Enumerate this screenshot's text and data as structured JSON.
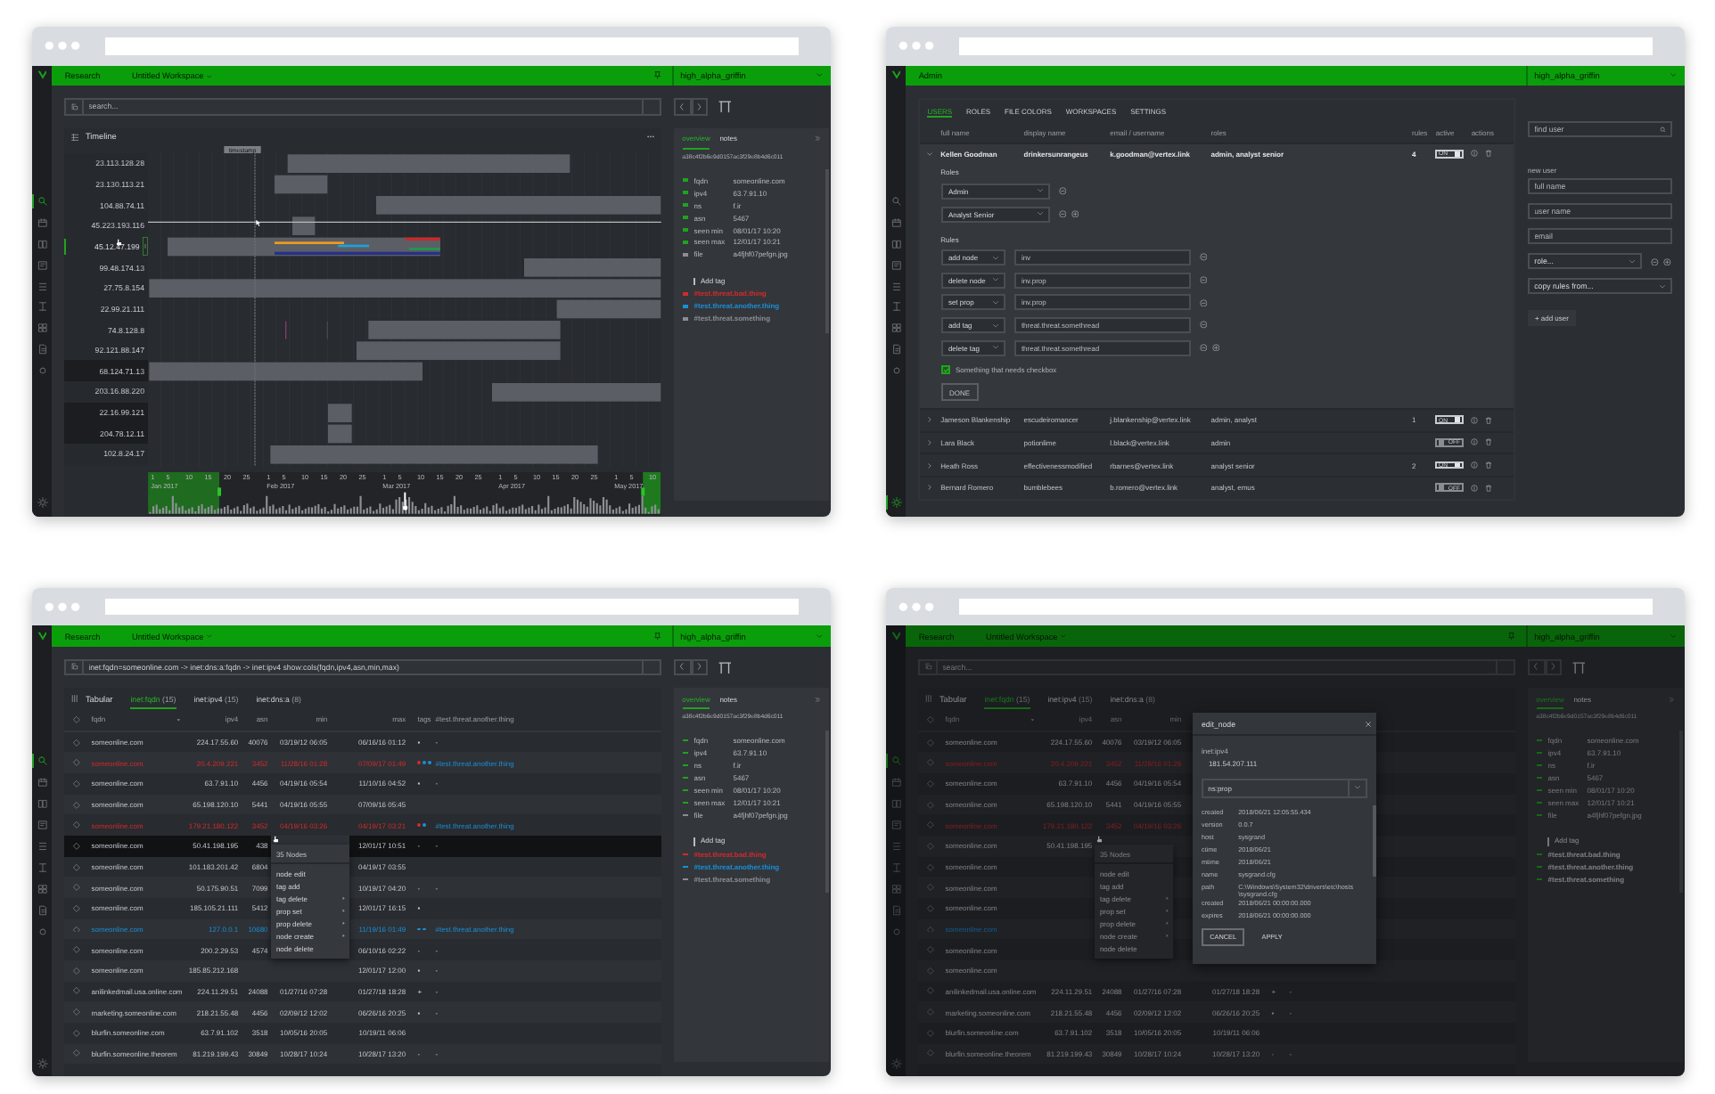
{
  "windows": [
    {
      "nav": [
        {
          "selected": true
        },
        {
          "selected": false
        },
        {
          "selected": false
        },
        {
          "selected": false
        },
        {
          "selected": false
        },
        {
          "selected": false
        },
        {
          "selected": false
        },
        {
          "selected": false
        },
        {
          "selected": false
        }
      ],
      "settings": {
        "selected": false
      },
      "topbar": {
        "section": "Research",
        "workspace": "Untitled Workspace",
        "user": "high_alpha_griffin"
      },
      "search": {
        "placeholder": "search..."
      },
      "center": {
        "kind": "timeline",
        "title": "Timeline",
        "cursor_label": "timestamp",
        "rows": [
          {
            "label": "23.113.128.28",
            "selected": false,
            "highlighted": false
          },
          {
            "label": "23.130.113.21",
            "selected": false,
            "highlighted": false
          },
          {
            "label": "104.88.74.11",
            "selected": false,
            "highlighted": false
          },
          {
            "label": "45.223.193.116",
            "selected": false,
            "highlighted": false
          },
          {
            "label": "45.12.47.199",
            "selected": true,
            "highlighted": false
          },
          {
            "label": "99.48.174.13",
            "selected": false,
            "highlighted": false
          },
          {
            "label": "27.75.8.154",
            "selected": false,
            "highlighted": false
          },
          {
            "label": "22.99.21.111",
            "selected": false,
            "highlighted": false
          },
          {
            "label": "74.8.128.8",
            "selected": false,
            "highlighted": false
          },
          {
            "label": "92.121.88.147",
            "selected": false,
            "highlighted": false
          },
          {
            "label": "68.124.71.13",
            "selected": false,
            "highlighted": true
          },
          {
            "label": "203.16.88.220",
            "selected": false,
            "highlighted": false
          },
          {
            "label": "22.16.99.121",
            "selected": false,
            "highlighted": true
          },
          {
            "label": "204.78.12.11",
            "selected": false,
            "highlighted": true
          },
          {
            "label": "102.8.24.17",
            "selected": false,
            "highlighted": false
          }
        ],
        "axis": [
          {
            "month": "Jan 2017",
            "days": [
              "1",
              "5",
              "10",
              "15",
              "20",
              "25"
            ]
          },
          {
            "month": "Feb 2017",
            "days": [
              "1",
              "5",
              "10",
              "15",
              "20",
              "25"
            ]
          },
          {
            "month": "Mar 2017",
            "days": [
              "1",
              "5",
              "10",
              "15",
              "20",
              "25"
            ]
          },
          {
            "month": "Apr 2017",
            "days": [
              "1",
              "5",
              "10",
              "15",
              "20",
              "25"
            ]
          },
          {
            "month": "May 2017",
            "days": [
              "1",
              "5",
              "10"
            ]
          }
        ]
      },
      "details": {
        "tabs": [
          {
            "label": "overview",
            "selected": true
          },
          {
            "label": "notes",
            "selected": false
          }
        ],
        "id": "a38c4f2b6e9d0157ac3f29e8b4d6c011",
        "props": [
          {
            "key": "fqdn",
            "value": "someonline.com",
            "color": "#1fa31f"
          },
          {
            "key": "ipv4",
            "value": "63.7.91.10",
            "color": "#1fa31f"
          },
          {
            "key": "ns",
            "value": "f.ir",
            "color": "#1fa31f"
          },
          {
            "key": "asn",
            "value": "5467",
            "color": "#1fa31f"
          },
          {
            "key": "seen min",
            "value": "08/01/17 10:20",
            "color": "#1fa31f"
          },
          {
            "key": "seen max",
            "value": "12/01/17 10:21",
            "color": "#1fa31f"
          },
          {
            "key": "file",
            "value": "a4fjhf07pefgn.jpg",
            "color": "#8a8e93"
          }
        ],
        "add_tag": "Add tag",
        "tags": [
          {
            "label": "#test.threat.bad.thing",
            "color": "#d22b2b"
          },
          {
            "label": "#test.threat.another.thing",
            "color": "#1a8fd6"
          },
          {
            "label": "#test.threat.something",
            "color": "#8a8e93"
          }
        ]
      }
    },
    {
      "nav": [
        {
          "selected": false
        },
        {
          "selected": false
        },
        {
          "selected": false
        },
        {
          "selected": false
        },
        {
          "selected": false
        },
        {
          "selected": false
        },
        {
          "selected": false
        },
        {
          "selected": false
        },
        {
          "selected": false
        }
      ],
      "settings": {
        "selected": true
      },
      "topbar": {
        "section": "Admin",
        "user": "high_alpha_griffin"
      },
      "center": {
        "kind": "admin",
        "tabs": [
          {
            "label": "USERS",
            "selected": true
          },
          {
            "label": "ROLES",
            "selected": false
          },
          {
            "label": "FILE COLORS",
            "selected": false
          },
          {
            "label": "WORKSPACES",
            "selected": false
          },
          {
            "label": "SETTINGS",
            "selected": false
          }
        ],
        "columns": [
          "full name",
          "display name",
          "email / username",
          "roles",
          "rules",
          "active",
          "actions"
        ],
        "users": [
          {
            "name": "Kellen Goodman",
            "display": "drinkersunrangeus",
            "email": "k.goodman@vertex.link",
            "roles": "admin, analyst senior",
            "rules": "4",
            "active": true,
            "active_label": "ON",
            "expanded": true
          },
          {
            "name": "Jameson Blankenship",
            "display": "escudeiromancer",
            "email": "j.blankenship@vertex.link",
            "roles": "admin, analyst",
            "rules": "1",
            "active": true,
            "active_label": "ON",
            "expanded": false
          },
          {
            "name": "Lara Black",
            "display": "potionlime",
            "email": "l.black@vertex.link",
            "roles": "admin",
            "active": false,
            "active_label": "OFF",
            "expanded": false
          },
          {
            "name": "Heath Ross",
            "display": "effectivenessmodified",
            "email": "rbarnes@vertex.link",
            "roles": "analyst senior",
            "rules": "2",
            "active": true,
            "active_label": "ON",
            "expanded": false
          },
          {
            "name": "Bernard Romero",
            "display": "bumblebees",
            "email": "b.romero@vertex.link",
            "roles": "analyst, emus",
            "active": false,
            "active_label": "OFF",
            "expanded": false
          }
        ],
        "editor": {
          "roles_label": "Roles",
          "roles": [
            "Admin",
            "Analyst Senior"
          ],
          "rules_label": "Rules",
          "rules": [
            {
              "action": "add node",
              "value": "inv"
            },
            {
              "action": "delete node",
              "value": "inv.prop"
            },
            {
              "action": "set prop",
              "value": "inv.prop"
            },
            {
              "action": "add tag",
              "value": "threat.threat.somethread"
            },
            {
              "action": "delete tag",
              "value": "threat.threat.somethread"
            }
          ],
          "checkbox": {
            "label": "Something that needs checkbox",
            "checked": true
          },
          "done": "DONE"
        }
      },
      "user_form": {
        "search_placeholder": "find user",
        "title": "new user",
        "fields": [
          {
            "placeholder": "full name"
          },
          {
            "placeholder": "user name"
          },
          {
            "placeholder": "email"
          }
        ],
        "role_select": "role...",
        "copy_select": "copy rules from...",
        "add": "+ add user"
      }
    },
    {
      "nav": [
        {
          "selected": true
        },
        {
          "selected": false
        },
        {
          "selected": false
        },
        {
          "selected": false
        },
        {
          "selected": false
        },
        {
          "selected": false
        },
        {
          "selected": false
        },
        {
          "selected": false
        },
        {
          "selected": false
        }
      ],
      "settings": {
        "selected": false
      },
      "topbar": {
        "section": "Research",
        "workspace": "Untitled Workspace",
        "user": "high_alpha_griffin"
      },
      "search": {
        "value": "inet:fqdn=someonline.com -> inet:dns:a:fqdn -> inet:ipv4 show:cols(fqdn,ipv4,asn,min,max)"
      },
      "center": {
        "kind": "table",
        "title": "Tabular",
        "tabs": [
          {
            "label": "inet:fqdn",
            "count": "(15)",
            "selected": true
          },
          {
            "label": "inet:ipv4",
            "count": "(15)",
            "selected": false
          },
          {
            "label": "inet:dns:a",
            "count": "(8)",
            "selected": false
          }
        ],
        "columns": [
          "fqdn",
          "ipv4",
          "asn",
          "min",
          "max",
          "tags",
          "#test.threat.another.thing"
        ],
        "rows": [
          {
            "fqdn": "someonline.com",
            "ipv4": "224.17.55.60",
            "asn": "40076",
            "min": "03/19/12 06:05",
            "max": "06/16/16 01:12",
            "tag_text": "▪",
            "note": "-",
            "flagged": false,
            "watched": false,
            "selected": false
          },
          {
            "fqdn": "someonline.com",
            "ipv4": "20.4.209.221",
            "asn": "3452",
            "min": "11/28/16 01:28",
            "max": "07/09/17 01:49",
            "tags": [
              {
                "color": "#d22b2b"
              },
              {
                "color": "#1a8fd6"
              },
              {
                "color": "#1a8fd6"
              }
            ],
            "note": "#test.threat.another.thing",
            "flagged": true,
            "watched": false,
            "selected": false
          },
          {
            "fqdn": "someonline.com",
            "ipv4": "63.7.91.10",
            "asn": "4456",
            "min": "04/19/16 05:54",
            "max": "11/10/16 04:52",
            "tag_text": "▪",
            "note": "-",
            "flagged": false,
            "watched": false,
            "selected": false
          },
          {
            "fqdn": "someonline.com",
            "ipv4": "65.198.120.10",
            "asn": "5441",
            "min": "04/19/16 05:55",
            "max": "07/09/16 05:45",
            "flagged": false,
            "watched": false,
            "selected": false
          },
          {
            "fqdn": "someonline.com",
            "ipv4": "179.21.180.122",
            "asn": "3452",
            "min": "04/19/16 03:26",
            "max": "04/19/17 03:21",
            "tags": [
              {
                "color": "#d22b2b"
              },
              {
                "color": "#1a8fd6"
              }
            ],
            "note": "#test.threat.another.thing",
            "flagged": true,
            "watched": false,
            "selected": false
          },
          {
            "fqdn": "someonline.com",
            "ipv4": "50.41.198.195",
            "asn": "438",
            "max": "12/01/17 10:51",
            "tag_text": "-",
            "note": "-",
            "flagged": false,
            "watched": false,
            "selected": true
          },
          {
            "fqdn": "someonline.com",
            "ipv4": "101.183.201.42",
            "asn": "6804",
            "max": "04/19/17 03:55",
            "flagged": false,
            "watched": false,
            "selected": false
          },
          {
            "fqdn": "someonline.com",
            "ipv4": "50.175.90.51",
            "asn": "7099",
            "max": "10/19/17 04:20",
            "tag_text": "-",
            "note": "-",
            "flagged": false,
            "watched": false,
            "selected": false
          },
          {
            "fqdn": "someonline.com",
            "ipv4": "185.105.21.111",
            "asn": "5412",
            "max": "12/01/17 16:15",
            "tag_text": "▪",
            "flagged": false,
            "watched": false,
            "selected": false
          },
          {
            "fqdn": "someonline.com",
            "ipv4": "127.0.0.1",
            "asn": "10680",
            "max": "11/19/16 01:49",
            "tags": [
              {
                "color": "#1a8fd6"
              },
              {
                "color": "#1a8fd6"
              }
            ],
            "note": "#test.threat.another.thing",
            "flagged": false,
            "watched": true,
            "selected": false
          },
          {
            "fqdn": "someonline.com",
            "ipv4": "200.2.29.53",
            "asn": "4574",
            "max": "06/10/16 02:22",
            "tag_text": "-",
            "note": "-",
            "flagged": false,
            "watched": false,
            "selected": false
          },
          {
            "fqdn": "someonline.com",
            "ipv4": "185.85.212.168",
            "max": "12/01/17 12:00",
            "tag_text": "▪",
            "note": "-",
            "flagged": false,
            "watched": false,
            "selected": false
          },
          {
            "fqdn": "anilinkedmail.usa.online.com",
            "ipv4": "224.11.29.51",
            "asn": "24088",
            "min": "01/27/16 07:28",
            "max": "01/27/18 18:28",
            "tag_text": "+",
            "note": "-",
            "flagged": false,
            "watched": false,
            "selected": false
          },
          {
            "fqdn": "marketing.someonline.com",
            "ipv4": "218.21.55.48",
            "asn": "4456",
            "min": "02/09/12 12:02",
            "max": "06/26/16 20:25",
            "tag_text": "▪",
            "note": "-",
            "flagged": false,
            "watched": false,
            "selected": false
          },
          {
            "fqdn": "blurfin.someonline.com",
            "ipv4": "63.7.91.102",
            "asn": "3518",
            "min": "10/05/16 20:05",
            "max": "10/19/11 06:06",
            "flagged": false,
            "watched": false,
            "selected": false
          },
          {
            "fqdn": "blurfin.someonline.theorem",
            "ipv4": "81.219.199.43",
            "asn": "30849",
            "min": "10/28/17 10:24",
            "max": "10/28/17 13:20",
            "tag_text": "-",
            "note": "-",
            "flagged": false,
            "watched": false,
            "selected": false
          }
        ]
      },
      "menu": {
        "title": "35 Nodes",
        "items": [
          {
            "label": "node edit",
            "submenu": false
          },
          {
            "label": "tag add",
            "submenu": false
          },
          {
            "label": "tag delete",
            "submenu": true
          },
          {
            "label": "prop set",
            "submenu": true
          },
          {
            "label": "prop delete",
            "submenu": true
          },
          {
            "label": "node create",
            "submenu": true
          },
          {
            "label": "node delete",
            "submenu": false
          }
        ]
      },
      "details": {
        "tabs": [
          {
            "label": "overview",
            "selected": true
          },
          {
            "label": "notes",
            "selected": false
          }
        ],
        "id": "a38c4f2b6e9d0157ac3f29e8b4d6c011",
        "props": [
          {
            "key": "fqdn",
            "value": "someonline.com",
            "color": "#1fa31f"
          },
          {
            "key": "ipv4",
            "value": "63.7.91.10",
            "color": "#1fa31f"
          },
          {
            "key": "ns",
            "value": "f.ir",
            "color": "#1fa31f"
          },
          {
            "key": "asn",
            "value": "5467",
            "color": "#1fa31f"
          },
          {
            "key": "seen min",
            "value": "08/01/17 10:20",
            "color": "#1fa31f"
          },
          {
            "key": "seen max",
            "value": "12/01/17 10:21",
            "color": "#1fa31f"
          },
          {
            "key": "file",
            "value": "a4fjhf07pefgn.jpg",
            "color": "#8a8e93"
          }
        ],
        "add_tag": "Add tag",
        "tags": [
          {
            "label": "#test.threat.bad.thing",
            "color": "#d22b2b"
          },
          {
            "label": "#test.threat.another.thing",
            "color": "#1a8fd6"
          },
          {
            "label": "#test.threat.something",
            "color": "#8a8e93"
          }
        ]
      }
    },
    {
      "nav": [
        {
          "selected": true
        },
        {
          "selected": false
        },
        {
          "selected": false
        },
        {
          "selected": false
        },
        {
          "selected": false
        },
        {
          "selected": false
        },
        {
          "selected": false
        },
        {
          "selected": false
        },
        {
          "selected": false
        }
      ],
      "settings": {
        "selected": false
      },
      "topbar": {
        "section": "Research",
        "workspace": "Untitled Workspace",
        "user": "high_alpha_griffin"
      },
      "search": {
        "placeholder": "search..."
      },
      "center": {
        "kind": "table",
        "title": "Tabular",
        "tabs": [
          {
            "label": "inet:fqdn",
            "count": "(15)",
            "selected": true
          },
          {
            "label": "inet:ipv4",
            "count": "(15)",
            "selected": false
          },
          {
            "label": "inet:dns:a",
            "count": "(8)",
            "selected": false
          }
        ],
        "columns": [
          "fqdn",
          "ipv4",
          "asn",
          "min"
        ],
        "rows": [
          {
            "fqdn": "someonline.com",
            "ipv4": "224.17.55.60",
            "asn": "40076",
            "min": "03/19/12 06:05",
            "flagged": false,
            "watched": false
          },
          {
            "fqdn": "someonline.com",
            "ipv4": "20.4.209.221",
            "asn": "3452",
            "min": "11/28/16 01:28",
            "flagged": true,
            "watched": false
          },
          {
            "fqdn": "someonline.com",
            "ipv4": "63.7.91.10",
            "asn": "4456",
            "min": "04/19/16 05:54",
            "flagged": false,
            "watched": false
          },
          {
            "fqdn": "someonline.com",
            "ipv4": "65.198.120.10",
            "asn": "5441",
            "min": "04/19/16 05:55",
            "flagged": false,
            "watched": false
          },
          {
            "fqdn": "someonline.com",
            "ipv4": "179.21.180.122",
            "asn": "3452",
            "min": "04/19/16 03:26",
            "flagged": true,
            "watched": false
          },
          {
            "fqdn": "someonline.com",
            "ipv4": "50.41.198.195",
            "flagged": false,
            "watched": false
          },
          {
            "fqdn": "someonline.com",
            "flagged": false,
            "watched": false
          },
          {
            "fqdn": "someonline.com",
            "flagged": false,
            "watched": false
          },
          {
            "fqdn": "someonline.com",
            "flagged": false,
            "watched": false
          },
          {
            "fqdn": "someonline.com",
            "flagged": false,
            "watched": true
          },
          {
            "fqdn": "someonline.com",
            "flagged": false,
            "watched": false
          },
          {
            "fqdn": "someonline.com",
            "flagged": false,
            "watched": false
          },
          {
            "fqdn": "anilinkedmail.usa.online.com",
            "ipv4": "224.11.29.51",
            "asn": "24088",
            "min": "01/27/16 07:28",
            "max": "01/27/18 18:28",
            "tag_text": "+",
            "note": "-",
            "flagged": false,
            "watched": false
          },
          {
            "fqdn": "marketing.someonline.com",
            "ipv4": "218.21.55.48",
            "asn": "4456",
            "min": "02/09/12 12:02",
            "max": "06/26/16 20:25",
            "tag_text": "▪",
            "note": "-",
            "flagged": false,
            "watched": false
          },
          {
            "fqdn": "blurfin.someonline.com",
            "ipv4": "63.7.91.102",
            "asn": "3518",
            "min": "10/05/16 20:05",
            "max": "10/19/11 06:06",
            "flagged": false,
            "watched": false
          },
          {
            "fqdn": "blurfin.someonline.theorem",
            "ipv4": "81.219.199.43",
            "asn": "30849",
            "min": "10/28/17 10:24",
            "max": "10/28/17 13:20",
            "tag_text": "-",
            "note": "-",
            "flagged": false,
            "watched": false
          }
        ]
      },
      "menu": {
        "title": "35 Nodes",
        "items": [
          {
            "label": "node edit",
            "submenu": false
          },
          {
            "label": "tag add",
            "submenu": false
          },
          {
            "label": "tag delete",
            "submenu": true
          },
          {
            "label": "prop set",
            "submenu": true
          },
          {
            "label": "prop delete",
            "submenu": true
          },
          {
            "label": "node create",
            "submenu": true
          },
          {
            "label": "node delete",
            "submenu": false
          }
        ]
      },
      "details": {
        "tabs": [
          {
            "label": "overview",
            "selected": true
          },
          {
            "label": "notes",
            "selected": false
          }
        ],
        "id": "a38c4f2b6e9d0157ac3f29e8b4d6c011",
        "props": [
          {
            "key": "fqdn",
            "value": "someonline.com"
          },
          {
            "key": "ipv4",
            "value": "63.7.91.10"
          },
          {
            "key": "ns",
            "value": "f.ir"
          },
          {
            "key": "asn",
            "value": "5467"
          },
          {
            "key": "seen min",
            "value": "08/01/17 10:20"
          },
          {
            "key": "seen max",
            "value": "12/01/17 10:21"
          },
          {
            "key": "file",
            "value": "a4fjhf07pefgn.jpg"
          }
        ],
        "add_tag": "Add tag",
        "tags": [
          {
            "label": "#test.threat.bad.thing"
          },
          {
            "label": "#test.threat.another.thing"
          },
          {
            "label": "#test.threat.something"
          }
        ]
      },
      "dialog": {
        "title": "edit_node",
        "field_label": "inet:ipv4",
        "field_value": "181.54.207.111",
        "select": "ns:prop",
        "info": [
          {
            "key": "created",
            "value": "2018/06/21 12:05:55.434"
          },
          {
            "key": "version",
            "value": "0.0.7"
          },
          {
            "key": "host",
            "value": "sysgrand"
          },
          {
            "key": "ctime",
            "value": "2018/06/21"
          },
          {
            "key": "mtime",
            "value": "2018/06/21"
          },
          {
            "key": "name",
            "value": "sysgrand.cfg"
          },
          {
            "key": "path",
            "value": "C:\\Windows\\System32\\drivers\\etc\\hosts\\sysgrand.cfg"
          },
          {
            "key": "created",
            "value": "2018/06/21 00:00:00.000"
          },
          {
            "key": "expires",
            "value": "2018/06/21 00:00:00.000"
          }
        ],
        "buttons": [
          {
            "label": "CANCEL",
            "kind": "outline"
          },
          {
            "label": "APPLY",
            "kind": "text"
          }
        ]
      }
    }
  ]
}
